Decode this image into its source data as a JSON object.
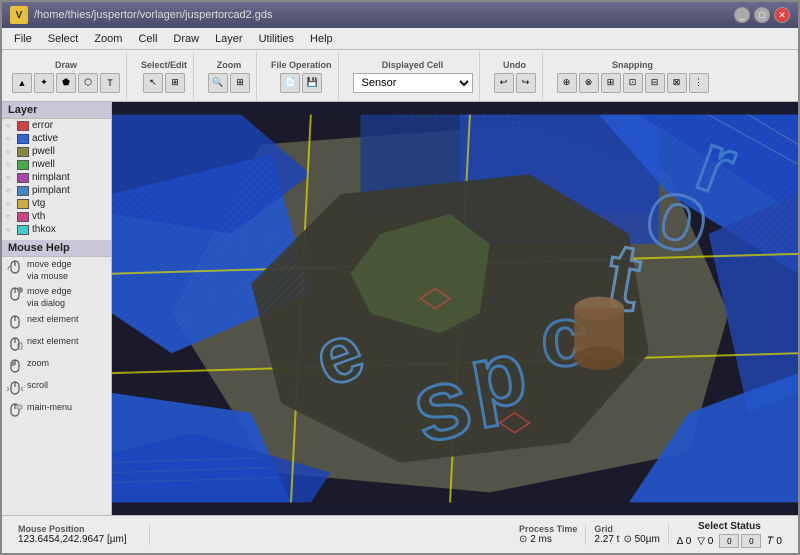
{
  "window": {
    "title": "/home/thies/juspertor/vorlagen/juspertorcad2.gds",
    "logo": "V"
  },
  "menu": {
    "items": [
      "File",
      "Select",
      "Zoom",
      "Cell",
      "Draw",
      "Layer",
      "Utilities",
      "Help"
    ]
  },
  "toolbars": {
    "draw": {
      "label": "Draw"
    },
    "select_edit": {
      "label": "Select/Edit"
    },
    "zoom": {
      "label": "Zoom"
    },
    "file_operation": {
      "label": "File Operation"
    },
    "displayed_cell": {
      "label": "Displayed Cell",
      "value": "Sensor"
    },
    "undo": {
      "label": "Undo"
    },
    "snapping": {
      "label": "Snapping"
    }
  },
  "sidebar": {
    "layer_title": "Layer",
    "layers": [
      {
        "name": "error",
        "color": "#cc4444",
        "pattern": "solid",
        "visible": true
      },
      {
        "name": "active",
        "color": "#4444cc",
        "pattern": "hatch",
        "visible": true
      },
      {
        "name": "pwell",
        "color": "#888844",
        "pattern": "dot",
        "visible": true
      },
      {
        "name": "nwell",
        "color": "#44aa44",
        "pattern": "hatch",
        "visible": true
      },
      {
        "name": "nimplant",
        "color": "#aa44aa",
        "pattern": "solid",
        "visible": true
      },
      {
        "name": "pimplant",
        "color": "#4488cc",
        "pattern": "hatch",
        "visible": true
      },
      {
        "name": "vtg",
        "color": "#ccaa44",
        "pattern": "solid",
        "visible": true
      },
      {
        "name": "vth",
        "color": "#cc4488",
        "pattern": "solid",
        "visible": true
      },
      {
        "name": "thkox",
        "color": "#44cccc",
        "pattern": "hatch",
        "visible": true
      }
    ],
    "mouse_help_title": "Mouse Help",
    "mouse_help_items": [
      {
        "icon": "mouse1",
        "text": "move edge\nvia mouse"
      },
      {
        "icon": "mouse2",
        "text": "move edge\nvia dialog"
      },
      {
        "icon": "mouse3",
        "text": "next element"
      },
      {
        "icon": "mouse4",
        "text": "next element"
      },
      {
        "icon": "mouse5",
        "text": "zoom"
      },
      {
        "icon": "mouse6",
        "text": "scroll"
      },
      {
        "icon": "mouse7",
        "text": "main-menu"
      }
    ]
  },
  "status_bar": {
    "mouse_pos_title": "Mouse Position",
    "mouse_pos_value": "123.6454,242.9647 [µm]",
    "process_time_label": "Process Time",
    "process_time_value": "⊙ 2 ms",
    "grid_label": "Grid",
    "grid_value": "2.27 t",
    "grid_size": "⊙ 50µm",
    "select_status_label": "Select Status",
    "angle_label": "∆ 0",
    "triangle_label": "▽ 0",
    "zero1": "0",
    "zero2": "0",
    "zero3": "0",
    "t_label": "𝑇 0"
  }
}
